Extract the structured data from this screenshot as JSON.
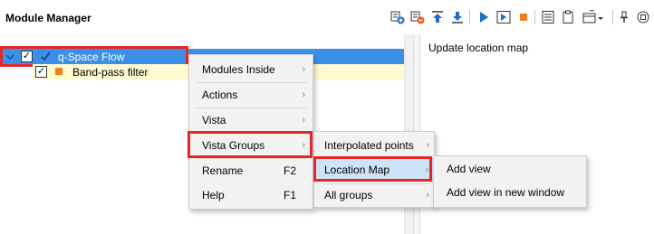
{
  "panel": {
    "title": "Module Manager"
  },
  "toolbar": {
    "buttons": [
      "add-module-icon",
      "remove-module-icon",
      "move-up-icon",
      "move-down-icon",
      "run-icon",
      "run-step-icon",
      "stop-icon",
      "list-view-icon",
      "clipboard-icon",
      "layout-dropdown-icon",
      "pin-icon",
      "restore-icon"
    ],
    "stop_color": "#f07f1b",
    "accent": "#1f6fc4"
  },
  "tree": {
    "rows": [
      {
        "label": "q-Space Flow",
        "checked": true,
        "selected": true
      },
      {
        "label": "Band-pass filter",
        "checked": true,
        "selected": false
      }
    ],
    "selection_color": "#3c8fe6",
    "module_color": "#f07f1b"
  },
  "right_pane": {
    "text": "Update location map"
  },
  "menus": {
    "main": {
      "items": [
        {
          "label": "Modules Inside",
          "submenu": true
        },
        {
          "label": "Actions",
          "submenu": true
        },
        {
          "label": "Vista",
          "submenu": true
        },
        {
          "label": "Vista Groups",
          "submenu": true
        },
        {
          "label": "Rename",
          "shortcut": "F2"
        },
        {
          "label": "Help",
          "shortcut": "F1"
        }
      ]
    },
    "vista_groups": {
      "items": [
        {
          "label": "Interpolated points",
          "submenu": true
        },
        {
          "label": "Location Map",
          "submenu": true
        },
        {
          "label": "All groups",
          "submenu": true
        }
      ]
    },
    "location_map": {
      "items": [
        {
          "label": "Add view"
        },
        {
          "label": "Add view in new window"
        }
      ]
    }
  },
  "highlight_color": "#e8262a"
}
